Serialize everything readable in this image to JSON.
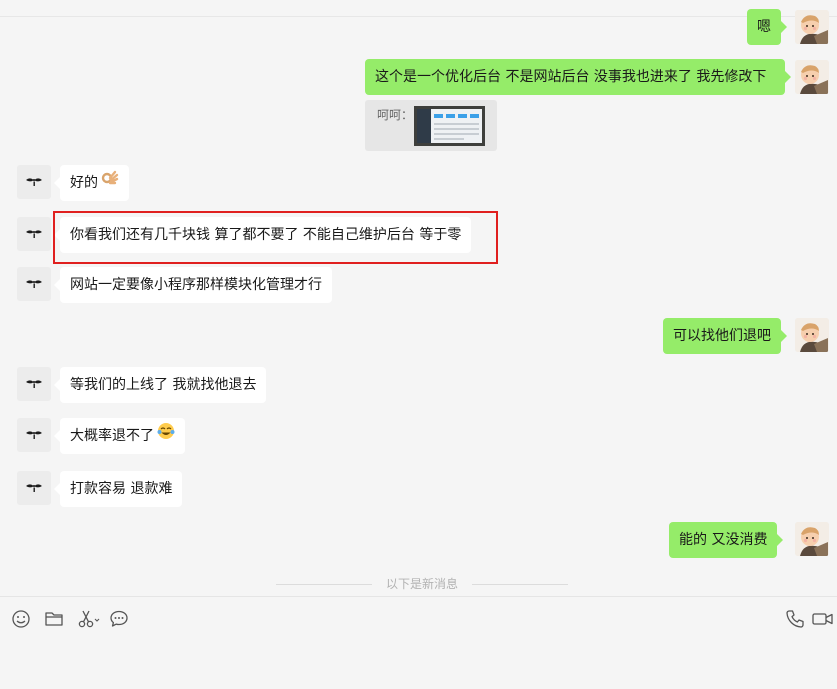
{
  "chat": {
    "messages": [
      {
        "side": "out",
        "text": "嗯"
      },
      {
        "side": "out",
        "text": "这个是一个优化后台  不是网站后台 没事我也进来了 我先修改下"
      },
      {
        "side": "out",
        "type": "quote",
        "label": "呵呵："
      },
      {
        "side": "in",
        "text": "好的",
        "emoji": "ok-hand"
      },
      {
        "side": "in",
        "text": "你看我们还有几千块钱 算了都不要了 不能自己维护后台 等于零"
      },
      {
        "side": "in",
        "text": "网站一定要像小程序那样模块化管理才行"
      },
      {
        "side": "out",
        "text": "可以找他们退吧"
      },
      {
        "side": "in",
        "text": "等我们的上线了 我就找他退去"
      },
      {
        "side": "in",
        "text": "大概率退不了",
        "emoji": "tears-of-joy"
      },
      {
        "side": "in",
        "text": "打款容易 退款难"
      },
      {
        "side": "out",
        "text": "能的 又没消费"
      }
    ],
    "new_messages_divider": "以下是新消息"
  },
  "toolbar": {
    "left_icons": [
      "emoji-icon",
      "folder-icon",
      "scissors-icon",
      "chat-history-icon"
    ],
    "right_icons": [
      "phone-icon",
      "video-icon"
    ]
  },
  "colors": {
    "outgoing_bubble": "#95ec69",
    "incoming_bubble": "#ffffff",
    "background": "#f5f5f5",
    "highlight_border": "#e0201f"
  }
}
